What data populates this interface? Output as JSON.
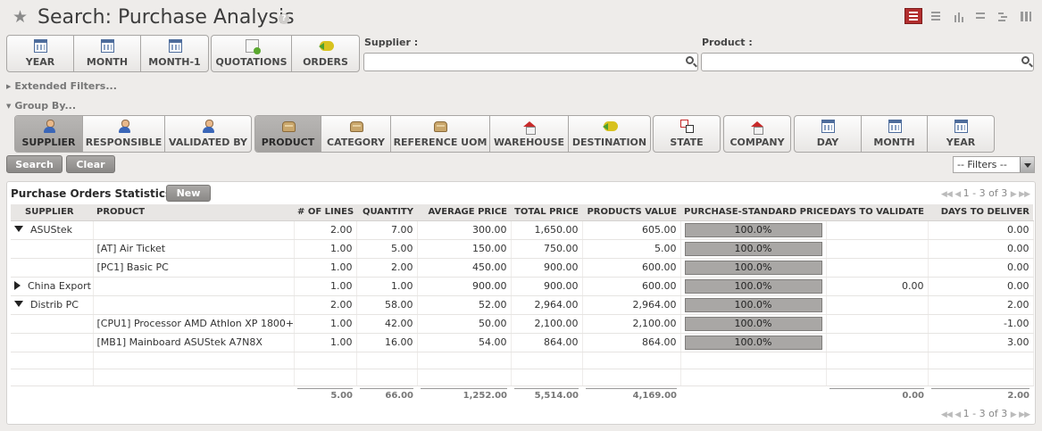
{
  "header": {
    "title": "Search: Purchase Analysis",
    "help": "?"
  },
  "filters": {
    "period": [
      "YEAR",
      "MONTH",
      "MONTH-1"
    ],
    "state": [
      "QUOTATIONS",
      "ORDERS"
    ],
    "supplier_label": "Supplier :",
    "supplier_value": "",
    "product_label": "Product :",
    "product_value": "",
    "extended": "Extended Filters...",
    "group_by": "Group By..."
  },
  "groupby": {
    "people": [
      "SUPPLIER",
      "RESPONSIBLE",
      "VALIDATED BY"
    ],
    "product": [
      "PRODUCT",
      "CATEGORY",
      "REFERENCE UOM",
      "WAREHOUSE",
      "DESTINATION"
    ],
    "state": "STATE",
    "company": "COMPANY",
    "dates": [
      "DAY",
      "MONTH",
      "YEAR"
    ]
  },
  "actions": {
    "search": "Search",
    "clear": "Clear",
    "filters_select": "-- Filters --"
  },
  "panel": {
    "title": "Purchase Orders Statistics",
    "new": "New",
    "pager": "1 - 3 of 3"
  },
  "table": {
    "columns": [
      "SUPPLIER",
      "PRODUCT",
      "# OF LINES",
      "QUANTITY",
      "AVERAGE PRICE",
      "TOTAL PRICE",
      "PRODUCTS VALUE",
      "PURCHASE-STANDARD PRICE",
      "DAYS TO VALIDATE",
      "DAYS TO DELIVER"
    ],
    "rows": [
      {
        "supplier": "ASUStek",
        "product": "",
        "lines": "2.00",
        "qty": "7.00",
        "avg": "300.00",
        "total": "1,650.00",
        "value": "605.00",
        "ratio": "100.0%",
        "validate": "",
        "deliver": "0.00"
      },
      {
        "supplier": "",
        "product": "[AT] Air Ticket",
        "lines": "1.00",
        "qty": "5.00",
        "avg": "150.00",
        "total": "750.00",
        "value": "5.00",
        "ratio": "100.0%",
        "validate": "",
        "deliver": "0.00"
      },
      {
        "supplier": "",
        "product": "[PC1] Basic PC",
        "lines": "1.00",
        "qty": "2.00",
        "avg": "450.00",
        "total": "900.00",
        "value": "600.00",
        "ratio": "100.0%",
        "validate": "",
        "deliver": "0.00"
      },
      {
        "supplier": "China Export",
        "product": "",
        "lines": "1.00",
        "qty": "1.00",
        "avg": "900.00",
        "total": "900.00",
        "value": "600.00",
        "ratio": "100.0%",
        "validate": "0.00",
        "deliver": "0.00"
      },
      {
        "supplier": "Distrib PC",
        "product": "",
        "lines": "2.00",
        "qty": "58.00",
        "avg": "52.00",
        "total": "2,964.00",
        "value": "2,964.00",
        "ratio": "100.0%",
        "validate": "",
        "deliver": "2.00"
      },
      {
        "supplier": "",
        "product": "[CPU1] Processor AMD Athlon XP 1800+",
        "lines": "1.00",
        "qty": "42.00",
        "avg": "50.00",
        "total": "2,100.00",
        "value": "2,100.00",
        "ratio": "100.0%",
        "validate": "",
        "deliver": "-1.00"
      },
      {
        "supplier": "",
        "product": "[MB1] Mainboard ASUStek A7N8X",
        "lines": "1.00",
        "qty": "16.00",
        "avg": "54.00",
        "total": "864.00",
        "value": "864.00",
        "ratio": "100.0%",
        "validate": "",
        "deliver": "3.00"
      }
    ],
    "totals": {
      "lines": "5.00",
      "qty": "66.00",
      "avg": "1,252.00",
      "total": "5,514.00",
      "value": "4,169.00",
      "validate": "0.00",
      "deliver": "2.00"
    }
  }
}
